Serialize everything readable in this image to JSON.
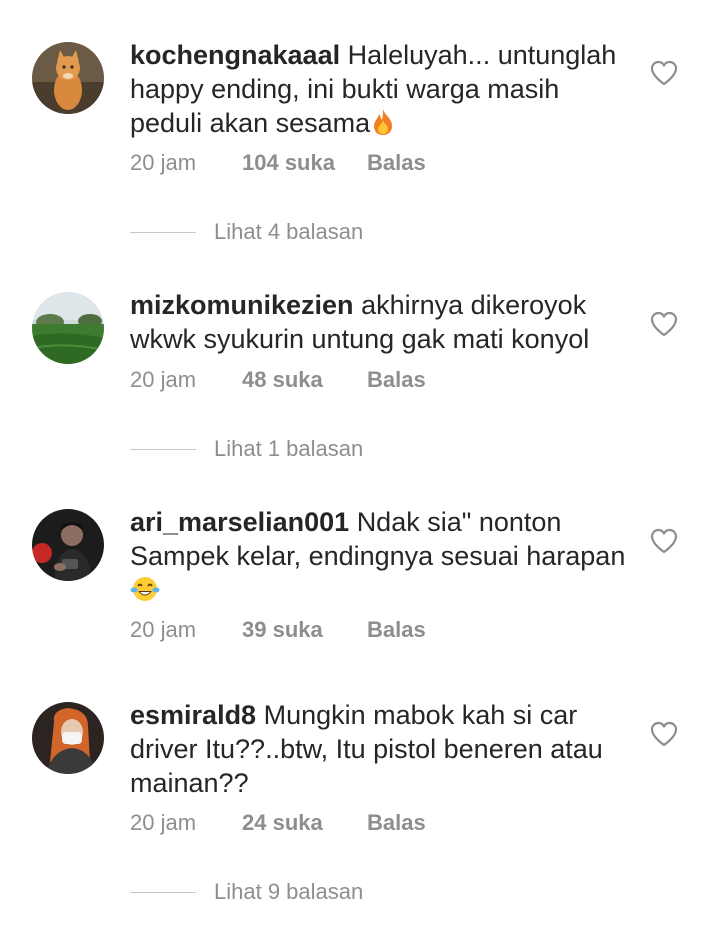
{
  "comments": [
    {
      "username": "kochengnakaaal",
      "text": "Haleluyah... untunglah happy ending, ini bukti warga masih peduli akan sesama",
      "emoji": "fire",
      "time": "20 jam",
      "likes": "104 suka",
      "reply": "Balas",
      "view_replies": "Lihat 4 balasan",
      "avatar": "cat-photo"
    },
    {
      "username": "mizkomunikezien",
      "text": "akhirnya dikeroyok wkwk syukurin untung gak mati konyol",
      "emoji": "",
      "time": "20 jam",
      "likes": "48 suka",
      "reply": "Balas",
      "view_replies": "Lihat 1 balasan",
      "avatar": "landscape-photo"
    },
    {
      "username": "ari_marselian001",
      "text": "Ndak sia\" nonton Sampek kelar, endingnya sesuai harapan",
      "emoji": "tears-of-joy",
      "time": "20 jam",
      "likes": "39 suka",
      "reply": "Balas",
      "view_replies": "",
      "avatar": "man-photo"
    },
    {
      "username": "esmirald8",
      "text": "Mungkin mabok kah si car driver Itu??..btw, Itu pistol beneren atau mainan??",
      "emoji": "",
      "time": "20 jam",
      "likes": "24 suka",
      "reply": "Balas",
      "view_replies": "Lihat 9 balasan",
      "avatar": "woman-mask-photo"
    }
  ],
  "colors": {
    "text": "#262626",
    "muted": "#8e8e8e",
    "divider": "#c7c7c7"
  }
}
